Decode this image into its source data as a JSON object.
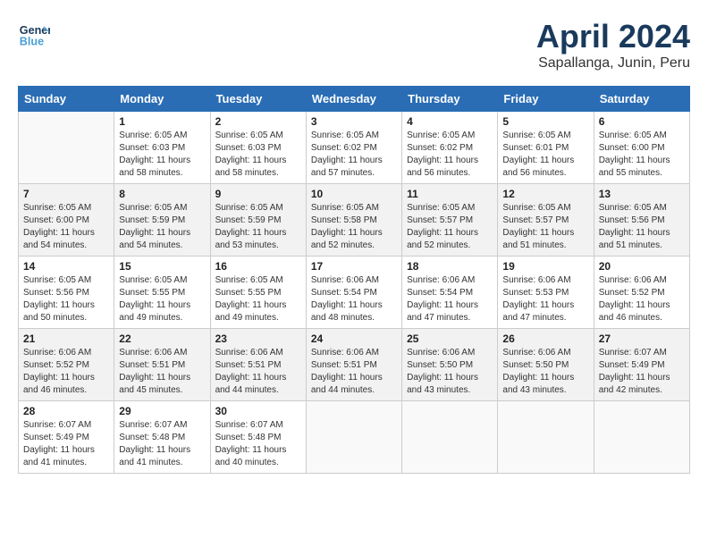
{
  "header": {
    "logo_line1": "General",
    "logo_line2": "Blue",
    "title": "April 2024",
    "subtitle": "Sapallanga, Junin, Peru"
  },
  "weekdays": [
    "Sunday",
    "Monday",
    "Tuesday",
    "Wednesday",
    "Thursday",
    "Friday",
    "Saturday"
  ],
  "weeks": [
    [
      {
        "day": "",
        "empty": true
      },
      {
        "day": "1",
        "sunrise": "6:05 AM",
        "sunset": "6:03 PM",
        "daylight": "11 hours and 58 minutes."
      },
      {
        "day": "2",
        "sunrise": "6:05 AM",
        "sunset": "6:03 PM",
        "daylight": "11 hours and 58 minutes."
      },
      {
        "day": "3",
        "sunrise": "6:05 AM",
        "sunset": "6:02 PM",
        "daylight": "11 hours and 57 minutes."
      },
      {
        "day": "4",
        "sunrise": "6:05 AM",
        "sunset": "6:02 PM",
        "daylight": "11 hours and 56 minutes."
      },
      {
        "day": "5",
        "sunrise": "6:05 AM",
        "sunset": "6:01 PM",
        "daylight": "11 hours and 56 minutes."
      },
      {
        "day": "6",
        "sunrise": "6:05 AM",
        "sunset": "6:00 PM",
        "daylight": "11 hours and 55 minutes."
      }
    ],
    [
      {
        "day": "7",
        "sunrise": "6:05 AM",
        "sunset": "6:00 PM",
        "daylight": "11 hours and 54 minutes."
      },
      {
        "day": "8",
        "sunrise": "6:05 AM",
        "sunset": "5:59 PM",
        "daylight": "11 hours and 54 minutes."
      },
      {
        "day": "9",
        "sunrise": "6:05 AM",
        "sunset": "5:59 PM",
        "daylight": "11 hours and 53 minutes."
      },
      {
        "day": "10",
        "sunrise": "6:05 AM",
        "sunset": "5:58 PM",
        "daylight": "11 hours and 52 minutes."
      },
      {
        "day": "11",
        "sunrise": "6:05 AM",
        "sunset": "5:57 PM",
        "daylight": "11 hours and 52 minutes."
      },
      {
        "day": "12",
        "sunrise": "6:05 AM",
        "sunset": "5:57 PM",
        "daylight": "11 hours and 51 minutes."
      },
      {
        "day": "13",
        "sunrise": "6:05 AM",
        "sunset": "5:56 PM",
        "daylight": "11 hours and 51 minutes."
      }
    ],
    [
      {
        "day": "14",
        "sunrise": "6:05 AM",
        "sunset": "5:56 PM",
        "daylight": "11 hours and 50 minutes."
      },
      {
        "day": "15",
        "sunrise": "6:05 AM",
        "sunset": "5:55 PM",
        "daylight": "11 hours and 49 minutes."
      },
      {
        "day": "16",
        "sunrise": "6:05 AM",
        "sunset": "5:55 PM",
        "daylight": "11 hours and 49 minutes."
      },
      {
        "day": "17",
        "sunrise": "6:06 AM",
        "sunset": "5:54 PM",
        "daylight": "11 hours and 48 minutes."
      },
      {
        "day": "18",
        "sunrise": "6:06 AM",
        "sunset": "5:54 PM",
        "daylight": "11 hours and 47 minutes."
      },
      {
        "day": "19",
        "sunrise": "6:06 AM",
        "sunset": "5:53 PM",
        "daylight": "11 hours and 47 minutes."
      },
      {
        "day": "20",
        "sunrise": "6:06 AM",
        "sunset": "5:52 PM",
        "daylight": "11 hours and 46 minutes."
      }
    ],
    [
      {
        "day": "21",
        "sunrise": "6:06 AM",
        "sunset": "5:52 PM",
        "daylight": "11 hours and 46 minutes."
      },
      {
        "day": "22",
        "sunrise": "6:06 AM",
        "sunset": "5:51 PM",
        "daylight": "11 hours and 45 minutes."
      },
      {
        "day": "23",
        "sunrise": "6:06 AM",
        "sunset": "5:51 PM",
        "daylight": "11 hours and 44 minutes."
      },
      {
        "day": "24",
        "sunrise": "6:06 AM",
        "sunset": "5:51 PM",
        "daylight": "11 hours and 44 minutes."
      },
      {
        "day": "25",
        "sunrise": "6:06 AM",
        "sunset": "5:50 PM",
        "daylight": "11 hours and 43 minutes."
      },
      {
        "day": "26",
        "sunrise": "6:06 AM",
        "sunset": "5:50 PM",
        "daylight": "11 hours and 43 minutes."
      },
      {
        "day": "27",
        "sunrise": "6:07 AM",
        "sunset": "5:49 PM",
        "daylight": "11 hours and 42 minutes."
      }
    ],
    [
      {
        "day": "28",
        "sunrise": "6:07 AM",
        "sunset": "5:49 PM",
        "daylight": "11 hours and 41 minutes."
      },
      {
        "day": "29",
        "sunrise": "6:07 AM",
        "sunset": "5:48 PM",
        "daylight": "11 hours and 41 minutes."
      },
      {
        "day": "30",
        "sunrise": "6:07 AM",
        "sunset": "5:48 PM",
        "daylight": "11 hours and 40 minutes."
      },
      {
        "day": "",
        "empty": true
      },
      {
        "day": "",
        "empty": true
      },
      {
        "day": "",
        "empty": true
      },
      {
        "day": "",
        "empty": true
      }
    ]
  ]
}
